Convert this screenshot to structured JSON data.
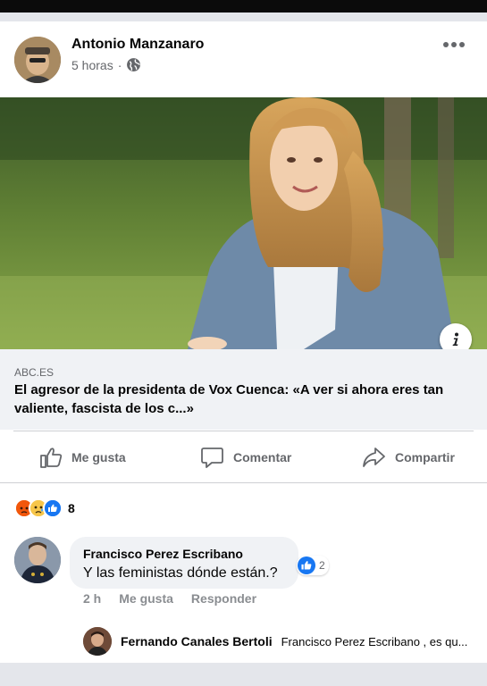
{
  "post": {
    "author": "Antonio Manzanaro",
    "time": "5 horas",
    "separator": "·",
    "privacy_icon": "globe-icon",
    "more_icon": "more-options-icon"
  },
  "link": {
    "domain": "ABC.ES",
    "title": "El agresor de la presidenta de Vox Cuenca: «A ver si ahora eres tan valiente, fascista de los c...»"
  },
  "actions": {
    "like": "Me gusta",
    "comment": "Comentar",
    "share": "Compartir"
  },
  "reactions": {
    "icons": [
      "angry-icon",
      "sad-icon",
      "like-icon"
    ],
    "count": "8"
  },
  "comment": {
    "author": "Francisco Perez Escribano",
    "text": "Y las feministas dónde están.?",
    "like_count": "2",
    "time": "2 h",
    "like_label": "Me gusta",
    "reply_label": "Responder"
  },
  "reply": {
    "author": "Fernando Canales Bertoli",
    "text": "Francisco Perez Escribano , es qu..."
  },
  "colors": {
    "facebook_blue": "#1877f2",
    "secondary_text": "#65676b",
    "link_background": "#f0f2f5"
  }
}
